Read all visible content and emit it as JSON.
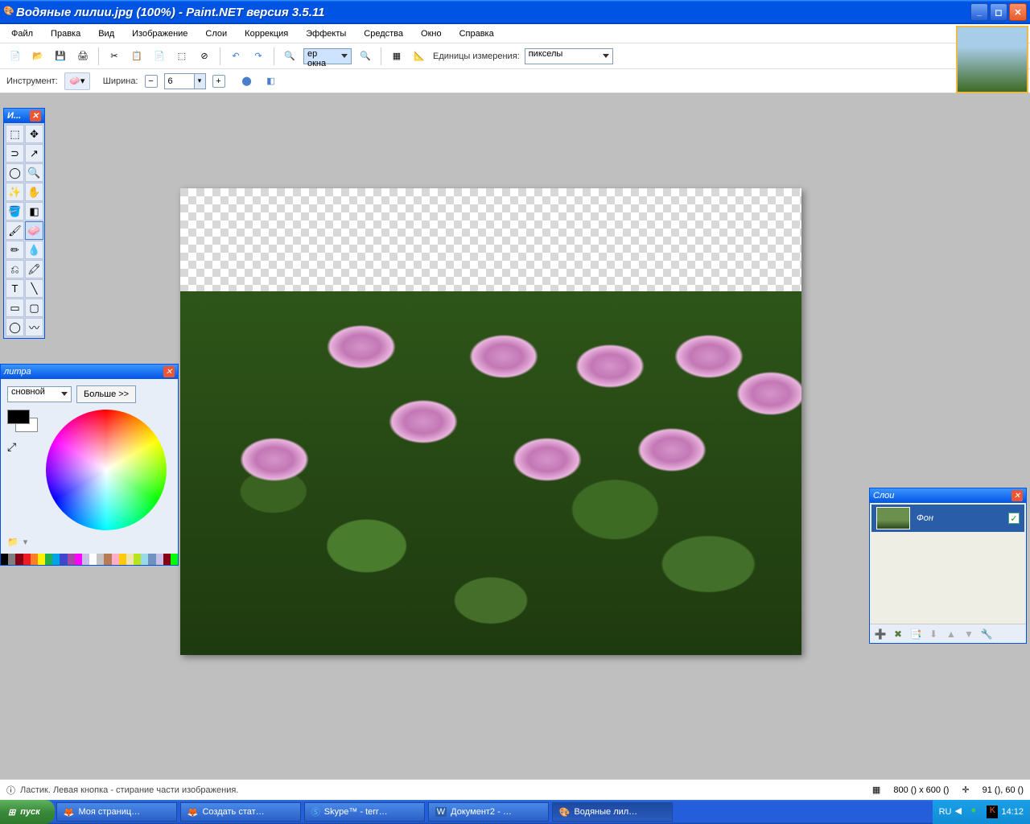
{
  "title": "Водяные лилии.jpg (100%) - Paint.NET версия 3.5.11",
  "menu": [
    "Файл",
    "Правка",
    "Вид",
    "Изображение",
    "Слои",
    "Коррекция",
    "Эффекты",
    "Средства",
    "Окно",
    "Справка"
  ],
  "toolbar": {
    "zoom_value": "ер окна",
    "units_label": "Единицы измерения:",
    "units_value": "пикселы"
  },
  "toolrow2": {
    "instrument_label": "Инструмент:",
    "width_label": "Ширина:",
    "width_value": "6"
  },
  "tools_panel": {
    "title": "И..."
  },
  "color_panel": {
    "title": "литра",
    "mode": "сновной",
    "more_btn": "Больше >>"
  },
  "layers_panel": {
    "title": "Слои",
    "layer_name": "Фон"
  },
  "status": {
    "left": "Ластик. Левая кнопка - стирание части изображения.",
    "size": "800 () x 600 ()",
    "pos": "91 (), 60 ()"
  },
  "taskbar": {
    "start": "пуск",
    "items": [
      "Моя страниц…",
      "Создать стат…",
      "Skype™ - terr…",
      "Документ2 - …",
      "Водяные лил…"
    ],
    "lang": "RU",
    "time": "14:12"
  },
  "swatch_colors": [
    "#000",
    "#7f7f7f",
    "#880015",
    "#ed1c24",
    "#ff7f27",
    "#fff200",
    "#22b14c",
    "#00a2e8",
    "#3f48cc",
    "#a349a4",
    "#ff00ff",
    "#c8bfe7",
    "#ffffff",
    "#c3c3c3",
    "#b97a57",
    "#ffaec9",
    "#ffc90e",
    "#efe4b0",
    "#b5e61d",
    "#99d9ea",
    "#7092be",
    "#c8bfe7",
    "#880015",
    "#00ff00"
  ]
}
